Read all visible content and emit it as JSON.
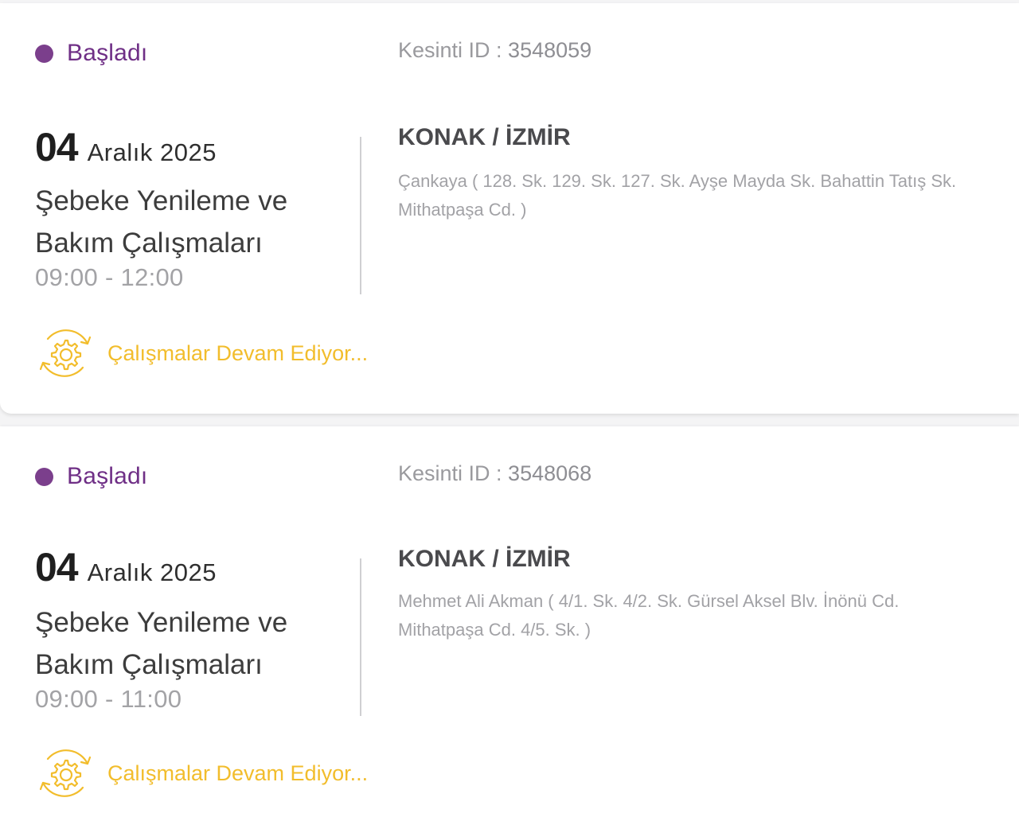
{
  "outages": [
    {
      "status": "Başladı",
      "id_label": "Kesinti ID : ",
      "id_value": "3548059",
      "day": "04",
      "month_year": "Aralık 2025",
      "work_title": "Şebeke Yenileme ve Bakım Çalışmaları",
      "time_range": "09:00 - 12:00",
      "location": "KONAK / İZMİR",
      "streets": "Çankaya ( 128. Sk. 129. Sk. 127. Sk. Ayşe Mayda Sk. Bahattin Tatış Sk. Mithatpaşa Cd. )",
      "progress_label": "Çalışmalar Devam Ediyor..."
    },
    {
      "status": "Başladı",
      "id_label": "Kesinti ID : ",
      "id_value": "3548068",
      "day": "04",
      "month_year": "Aralık 2025",
      "work_title": "Şebeke Yenileme ve Bakım Çalışmaları",
      "time_range": "09:00 - 11:00",
      "location": "KONAK / İZMİR",
      "streets": "Mehmet Ali Akman ( 4/1. Sk. 4/2. Sk. Gürsel Aksel Blv. İnönü Cd. Mithatpaşa Cd. 4/5. Sk. )",
      "progress_label": "Çalışmalar Devam Ediyor..."
    }
  ],
  "colors": {
    "status_dot": "#7b3f8c",
    "status_text": "#6f2f86",
    "progress_accent": "#f2bd2c",
    "muted_text": "#a2a2a6"
  },
  "icons": {
    "status": "status-dot-icon",
    "progress": "gear-refresh-icon"
  }
}
